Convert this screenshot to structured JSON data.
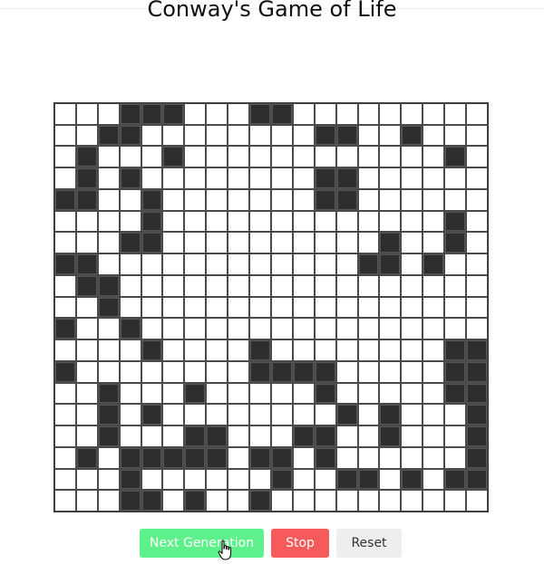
{
  "title": "Conway's Game of Life",
  "colors": {
    "alive": "#2e2e2e",
    "dead": "#ffffff",
    "next_button": "#5ef08a",
    "stop_button": "#f65a5a",
    "reset_button": "#eeeeee"
  },
  "board": {
    "cols": 20,
    "rows": 19,
    "grid": [
      "00011100011000000000",
      "00110000000011001000",
      "01000100000000000010",
      "01010000000011000000",
      "11001000000011000000",
      "00001000000000000010",
      "00011000000000010010",
      "11000000000000110100",
      "01100000000000000000",
      "00100000000000000000",
      "10010000000000000000",
      "00001000010000000011",
      "10000000011110000011",
      "00100010000010000011",
      "00101000000001010001",
      "00100011000110010001",
      "01011111011010000001",
      "00010000001001101011",
      "00011010010000000000"
    ]
  },
  "controls": {
    "next_label": "Next Generation",
    "stop_label": "Stop",
    "reset_label": "Reset"
  },
  "cursor_icon": "hand-pointer-icon"
}
